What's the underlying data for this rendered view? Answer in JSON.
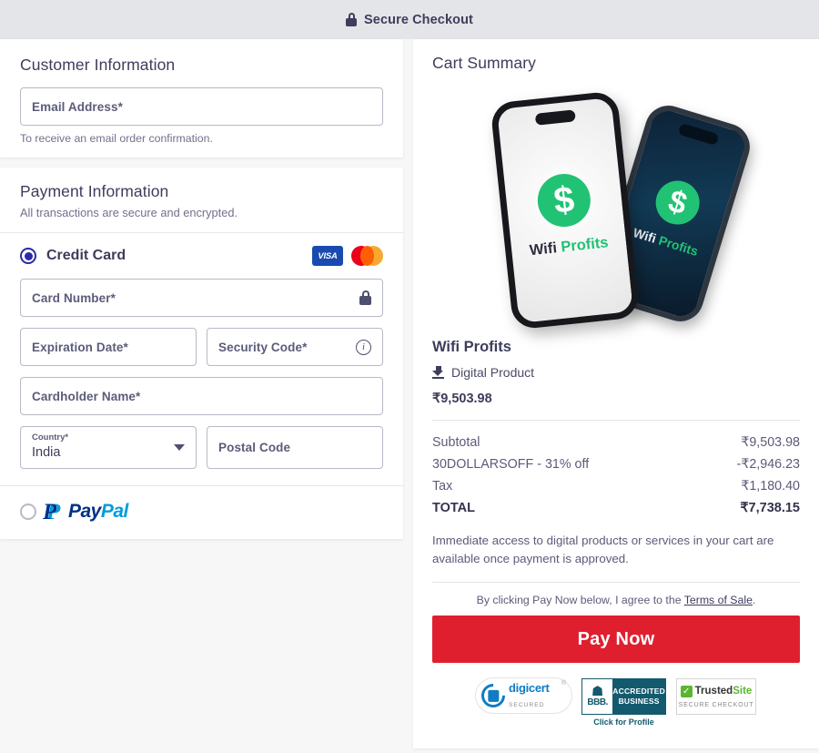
{
  "header": {
    "title": "Secure Checkout",
    "lock_icon": "lock-icon"
  },
  "customer": {
    "heading": "Customer Information",
    "email_placeholder": "Email Address*",
    "email_value": "",
    "helper": "To receive an email order confirmation."
  },
  "payment": {
    "heading": "Payment Information",
    "subheading": "All transactions are secure and encrypted.",
    "methods": {
      "credit_card": {
        "label": "Credit Card",
        "selected": true,
        "brands": [
          "VISA",
          "Mastercard"
        ]
      },
      "paypal": {
        "label": "PayPal",
        "label_part1": "Pay",
        "label_part2": "Pal",
        "selected": false
      }
    },
    "fields": {
      "card_number_placeholder": "Card Number*",
      "card_number_value": "",
      "card_number_icon": "lock-icon",
      "expiration_placeholder": "Expiration Date*",
      "expiration_value": "",
      "security_code_placeholder": "Security Code*",
      "security_code_value": "",
      "security_code_icon": "info-icon",
      "cardholder_placeholder": "Cardholder Name*",
      "cardholder_value": "",
      "country_label": "Country*",
      "country_value": "India",
      "postal_placeholder": "Postal Code",
      "postal_value": ""
    }
  },
  "cart": {
    "heading": "Cart Summary",
    "product": {
      "name": "Wifi Profits",
      "type_label": "Digital Product",
      "type_icon": "download-icon",
      "price": "₹9,503.98",
      "image_brand_word1": "Wifi ",
      "image_brand_word2": "Profits",
      "image_coin_symbol": "$"
    },
    "totals": [
      {
        "label": "Subtotal",
        "value": "₹9,503.98"
      },
      {
        "label": "30DOLLARSOFF - 31% off",
        "value": "-₹2,946.23"
      },
      {
        "label": "Tax",
        "value": "₹1,180.40"
      }
    ],
    "total": {
      "label": "TOTAL",
      "value": "₹7,738.15"
    },
    "note": "Immediate access to digital products or services in your cart are available once payment is approved.",
    "terms_prefix": "By clicking Pay Now below, I agree to the ",
    "terms_link": "Terms of Sale",
    "terms_suffix": ".",
    "pay_button": "Pay Now"
  },
  "badges": {
    "digicert": {
      "name": "digicert",
      "sub": "SECURED",
      "reg": "®"
    },
    "bbb": {
      "word": "BBB.",
      "line1": "ACCREDITED",
      "line2": "BUSINESS",
      "click": "Click for Profile"
    },
    "trustedsite": {
      "name1": "Trusted",
      "name2": "Site",
      "sub": "SECURE CHECKOUT"
    }
  },
  "colors": {
    "accent_pay": "#e01f2e",
    "radio_selected": "#2b2ba8",
    "brand_green": "#21c274",
    "header_bg": "#e4e5e9"
  }
}
